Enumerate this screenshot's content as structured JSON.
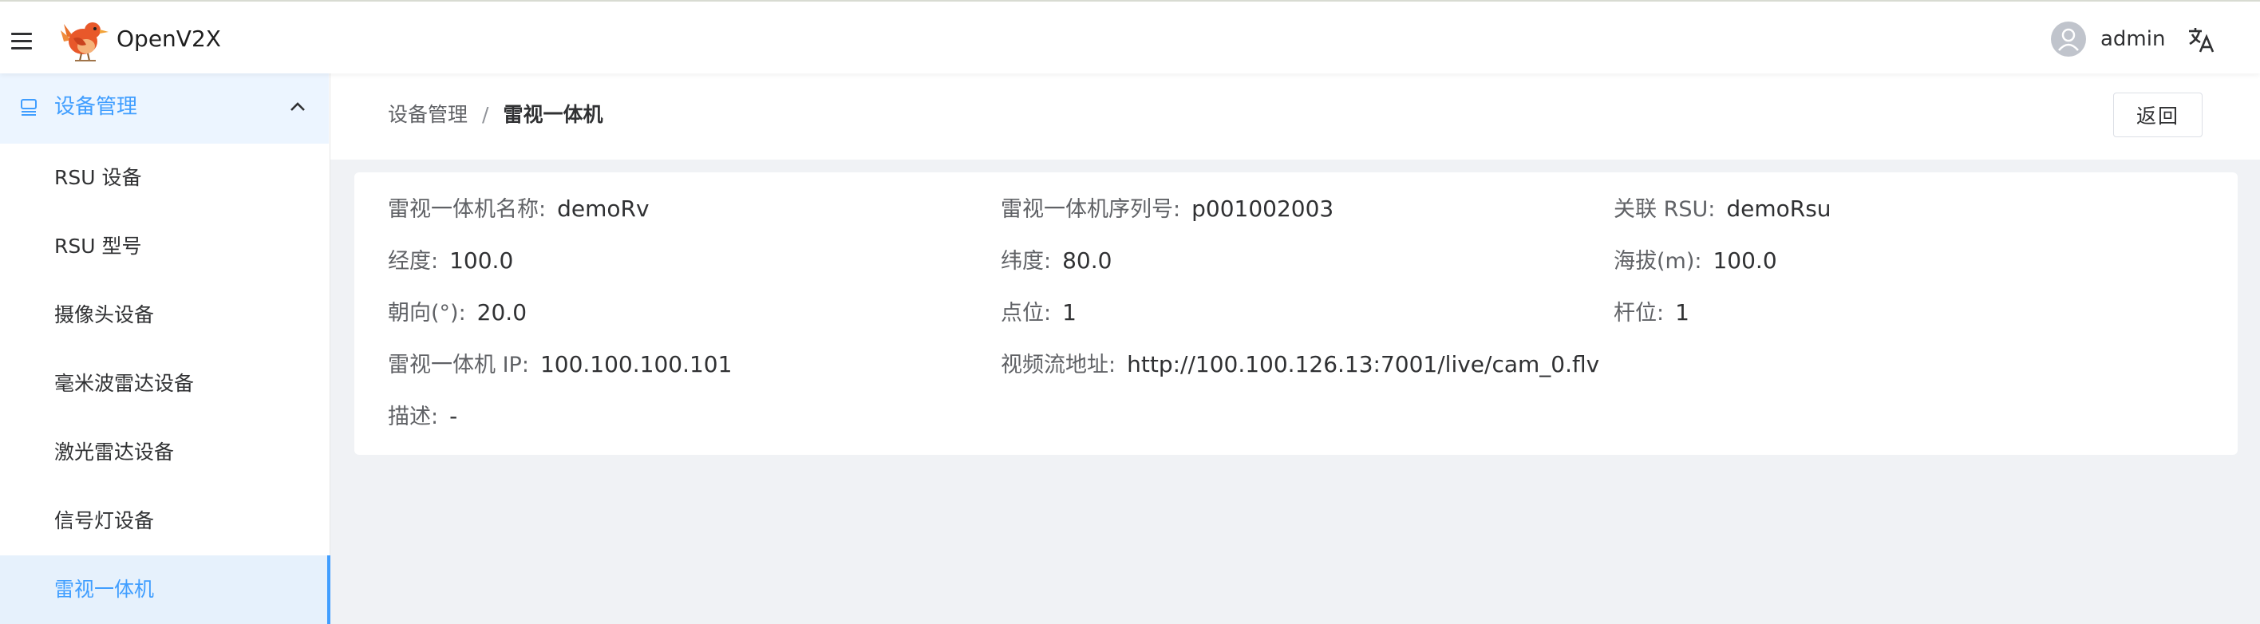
{
  "header": {
    "app_title": "OpenV2X",
    "menu_icon": "hamburger-icon",
    "logo_icon": "bird-logo-icon",
    "user": {
      "name": "admin",
      "avatar_icon": "user-avatar-icon"
    },
    "language_icon": "translate-icon"
  },
  "sidebar": {
    "group": {
      "label": "设备管理",
      "icon": "device-icon",
      "expanded": true
    },
    "items": [
      {
        "label": "RSU 设备",
        "active": false
      },
      {
        "label": "RSU 型号",
        "active": false
      },
      {
        "label": "摄像头设备",
        "active": false
      },
      {
        "label": "毫米波雷达设备",
        "active": false
      },
      {
        "label": "激光雷达设备",
        "active": false
      },
      {
        "label": "信号灯设备",
        "active": false
      },
      {
        "label": "雷视一体机",
        "active": true
      }
    ]
  },
  "breadcrumb": {
    "parent": "设备管理",
    "separator": "/",
    "current": "雷视一体机"
  },
  "actions": {
    "back_label": "返回"
  },
  "details": {
    "name": {
      "label": "雷视一体机名称:",
      "value": "demoRv"
    },
    "serial": {
      "label": "雷视一体机序列号:",
      "value": "p001002003"
    },
    "rsu": {
      "label": "关联 RSU:",
      "value": "demoRsu"
    },
    "longitude": {
      "label": "经度:",
      "value": "100.0"
    },
    "latitude": {
      "label": "纬度:",
      "value": "80.0"
    },
    "altitude": {
      "label": "海拔(m):",
      "value": "100.0"
    },
    "heading": {
      "label": "朝向(°):",
      "value": "20.0"
    },
    "point": {
      "label": "点位:",
      "value": "1"
    },
    "pole": {
      "label": "杆位:",
      "value": "1"
    },
    "ip": {
      "label": "雷视一体机 IP:",
      "value": "100.100.100.101"
    },
    "video_url": {
      "label": "视频流地址:",
      "value": "http://100.100.126.13:7001/live/cam_0.flv"
    },
    "description": {
      "label": "描述:",
      "value": "-"
    }
  },
  "colors": {
    "accent": "#409eff",
    "active_bg": "#e6f1fc",
    "page_bg": "#f0f2f5"
  }
}
